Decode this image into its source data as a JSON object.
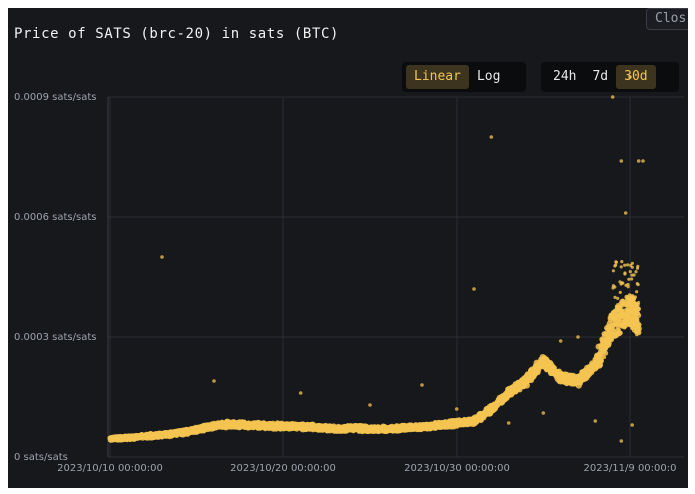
{
  "window": {
    "close_label": "Clos"
  },
  "chart_data": {
    "type": "scatter",
    "title": "Price of SATS (brc-20) in sats (BTC)",
    "xlabel": "",
    "ylabel": "",
    "ylim": [
      0,
      0.0009
    ],
    "y_unit": "sats/sats",
    "y_ticks": [
      {
        "value": 0,
        "label": "0 sats/sats"
      },
      {
        "value": 0.0003,
        "label": "0.0003 sats/sats"
      },
      {
        "value": 0.0006,
        "label": "0.0006 sats/sats"
      },
      {
        "value": 0.0009,
        "label": "0.0009 sats/sats"
      }
    ],
    "x_ticks": [
      {
        "value": "2023-10-10",
        "label": "2023/10/10 00:00:00"
      },
      {
        "value": "2023-10-20",
        "label": "2023/10/20 00:00:00"
      },
      {
        "value": "2023-10-30",
        "label": "2023/10/30 00:00:00"
      },
      {
        "value": "2023-11-09",
        "label": "2023/11/9 00:00:0"
      }
    ],
    "grid": true,
    "series_color": "#f5c451",
    "trend": [
      [
        "2023-10-10",
        4.5e-05
      ],
      [
        "2023-10-11",
        4.8e-05
      ],
      [
        "2023-10-12",
        5.2e-05
      ],
      [
        "2023-10-13",
        5.5e-05
      ],
      [
        "2023-10-14",
        6e-05
      ],
      [
        "2023-10-15",
        6.8e-05
      ],
      [
        "2023-10-16",
        7.8e-05
      ],
      [
        "2023-10-17",
        8.2e-05
      ],
      [
        "2023-10-18",
        8e-05
      ],
      [
        "2023-10-19",
        7.8e-05
      ],
      [
        "2023-10-20",
        7.7e-05
      ],
      [
        "2023-10-21",
        7.6e-05
      ],
      [
        "2023-10-22",
        7.4e-05
      ],
      [
        "2023-10-23",
        7e-05
      ],
      [
        "2023-10-24",
        7.2e-05
      ],
      [
        "2023-10-25",
        7e-05
      ],
      [
        "2023-10-26",
        7e-05
      ],
      [
        "2023-10-27",
        7.3e-05
      ],
      [
        "2023-10-28",
        7.5e-05
      ],
      [
        "2023-10-29",
        8e-05
      ],
      [
        "2023-10-30",
        8.5e-05
      ],
      [
        "2023-10-31",
        9e-05
      ],
      [
        "2023-11-01",
        0.00012
      ],
      [
        "2023-11-02",
        0.00016
      ],
      [
        "2023-11-03",
        0.00019
      ],
      [
        "2023-11-04",
        0.00024
      ],
      [
        "2023-11-05",
        0.0002
      ],
      [
        "2023-11-06",
        0.00019
      ],
      [
        "2023-11-07",
        0.00023
      ],
      [
        "2023-11-08",
        0.00033
      ],
      [
        "2023-11-09",
        0.00037
      ],
      [
        "2023-11-09 12:00",
        0.00034
      ]
    ],
    "outliers": [
      [
        "2023-10-13",
        0.0005
      ],
      [
        "2023-10-16",
        0.00019
      ],
      [
        "2023-10-21",
        0.00016
      ],
      [
        "2023-10-25",
        0.00013
      ],
      [
        "2023-10-28",
        0.00018
      ],
      [
        "2023-10-30",
        0.00012
      ],
      [
        "2023-10-31",
        0.00042
      ],
      [
        "2023-11-01",
        0.0008
      ],
      [
        "2023-11-02",
        8.5e-05
      ],
      [
        "2023-11-04",
        0.00011
      ],
      [
        "2023-11-05",
        0.00029
      ],
      [
        "2023-11-06",
        0.0003
      ],
      [
        "2023-11-07",
        9e-05
      ],
      [
        "2023-11-08",
        0.0009
      ],
      [
        "2023-11-08 12:00",
        0.00074
      ],
      [
        "2023-11-08 18:00",
        0.00061
      ],
      [
        "2023-11-09",
        0.00095
      ],
      [
        "2023-11-09 12:00",
        0.00074
      ],
      [
        "2023-11-09 18:00",
        0.00074
      ],
      [
        "2023-11-08 12:00",
        4e-05
      ],
      [
        "2023-11-09 03:00",
        8e-05
      ]
    ]
  },
  "controls": {
    "scale": [
      {
        "label": "Linear",
        "active": true
      },
      {
        "label": "Log",
        "active": false
      }
    ],
    "range": [
      {
        "label": "24h",
        "active": false
      },
      {
        "label": "7d",
        "active": false
      },
      {
        "label": "30d",
        "active": true
      }
    ]
  }
}
